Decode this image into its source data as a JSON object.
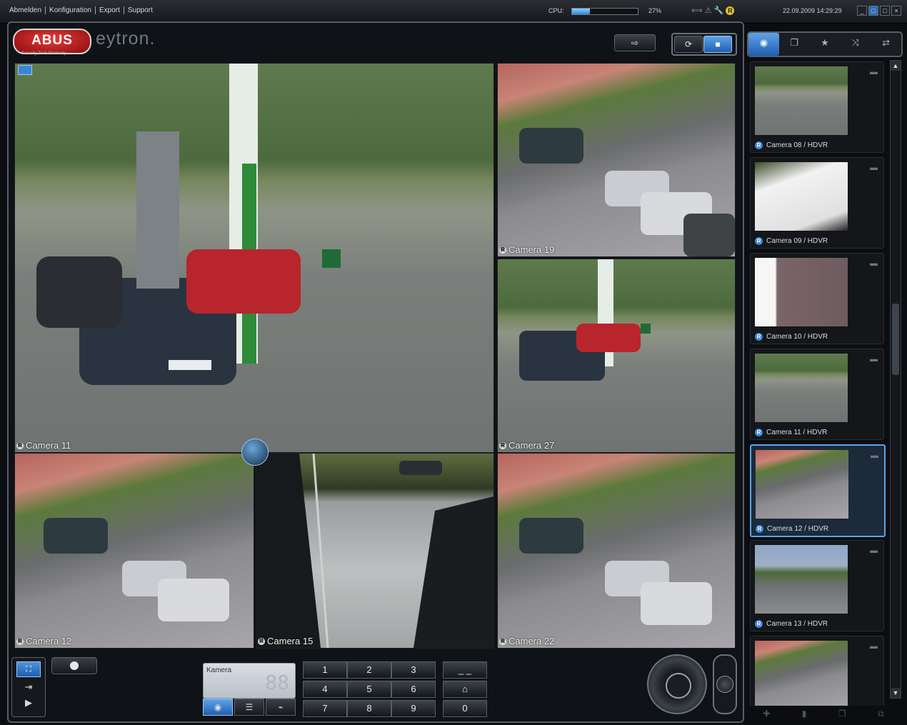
{
  "menu": [
    "Abmelden",
    "Konfiguration",
    "Export",
    "Support"
  ],
  "status": {
    "cpu_label": "CPU:",
    "cpu_percent": 27,
    "cpu_text": "27%",
    "status_badge": "R",
    "datetime": "22.09.2009 14:29:29"
  },
  "brand": {
    "logo_text": "ABUS",
    "logo_sub": "Security Tech Germany",
    "product": "eytron."
  },
  "view_buttons": {
    "export_icon": "export-icon",
    "refresh_icon": "refresh-icon",
    "stop_icon": "stop-icon"
  },
  "cameras": [
    {
      "label": "Camera 11",
      "badge": "R"
    },
    {
      "label": "Camera 19",
      "badge": "R"
    },
    {
      "label": "Camera 27",
      "badge": "R"
    },
    {
      "label": "Camera 12",
      "badge": "R"
    },
    {
      "label": "Camera 15",
      "badge": "R"
    },
    {
      "label": "Camera 22",
      "badge": "R"
    }
  ],
  "controls": {
    "kamera_label": "Kamera",
    "kamera_display": "88",
    "keypad": [
      "1",
      "2",
      "3",
      "4",
      "5",
      "6",
      "7",
      "8",
      "9"
    ],
    "key_dash": "_ _",
    "key_home": "⌂",
    "key_zero": "0"
  },
  "sidebar": {
    "tabs": [
      "camera-tab-icon",
      "layers-tab-icon",
      "favorites-tab-icon",
      "sequence-tab-icon",
      "swap-tab-icon"
    ],
    "items": [
      {
        "label": "Camera 08 / HDVR",
        "badge": "R"
      },
      {
        "label": "Camera 09 / HDVR",
        "badge": "R"
      },
      {
        "label": "Camera 10 / HDVR",
        "badge": "R"
      },
      {
        "label": "Camera 11 / HDVR",
        "badge": "R"
      },
      {
        "label": "Camera 12 / HDVR",
        "badge": "R"
      },
      {
        "label": "Camera 13 / HDVR",
        "badge": "R"
      }
    ],
    "selected_index": 4
  },
  "colors": {
    "accent": "#2f6fb5",
    "logo_red": "#c21a1a"
  }
}
